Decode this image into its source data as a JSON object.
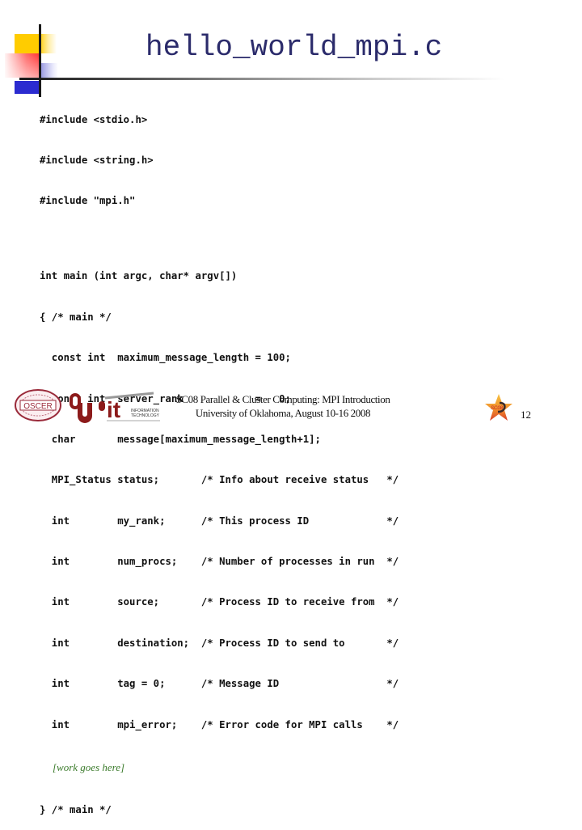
{
  "slide": {
    "title": "hello_world_mpi.c",
    "page_number": "12"
  },
  "code": {
    "lines": [
      "#include <stdio.h>",
      "#include <string.h>",
      "#include \"mpi.h\"",
      "",
      "int main (int argc, char* argv[])",
      "{ /* main */",
      "  const int  maximum_message_length = 100;",
      "  const int  server_rank            =   0;",
      "  char       message[maximum_message_length+1];",
      "  MPI_Status status;       /* Info about receive status   */",
      "  int        my_rank;      /* This process ID             */",
      "  int        num_procs;    /* Number of processes in run  */",
      "  int        source;       /* Process ID to receive from  */",
      "  int        destination;  /* Process ID to send to       */",
      "  int        tag = 0;      /* Message ID                  */",
      "  int        mpi_error;    /* Error code for MPI calls    */"
    ],
    "placeholder_note": "[work goes here]",
    "closing_line": "} /* main */"
  },
  "footer": {
    "line1": "SC08 Parallel & Cluster Computing: MPI Introduction",
    "line2": "University of Oklahoma, August 10-16 2008"
  },
  "logos": {
    "oscer": "OSCER",
    "ou": "OU",
    "it": "it",
    "it_sub1": "INFORMATION",
    "it_sub2": "TECHNOLOGY",
    "sc08": "SC08"
  },
  "colors": {
    "title": "#2b2b6b",
    "note": "#3a7a2a",
    "ou_crimson": "#8c1a1a",
    "oscer": "#9a2a3a"
  }
}
